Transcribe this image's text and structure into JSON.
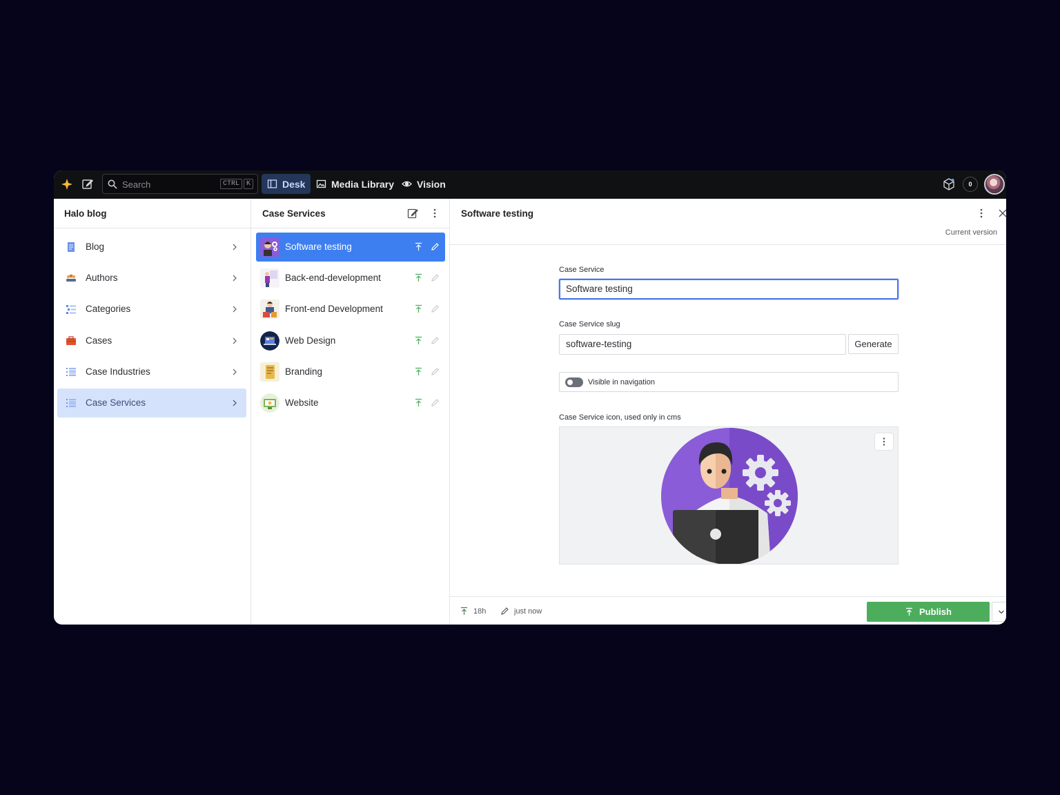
{
  "topbar": {
    "search_placeholder": "Search",
    "shortcut_keys": [
      "CTRL",
      "K"
    ],
    "nav": [
      {
        "label": "Desk",
        "icon": "desk-icon",
        "active": true
      },
      {
        "label": "Media Library",
        "icon": "image-icon",
        "active": false
      },
      {
        "label": "Vision",
        "icon": "eye-icon",
        "active": false
      }
    ],
    "notification_count": "0"
  },
  "structure": {
    "title": "Halo blog",
    "items": [
      {
        "label": "Blog",
        "icon": "document-icon",
        "selected": false
      },
      {
        "label": "Authors",
        "icon": "people-icon",
        "selected": false
      },
      {
        "label": "Categories",
        "icon": "list-icon",
        "selected": false
      },
      {
        "label": "Cases",
        "icon": "briefcase-icon",
        "selected": false
      },
      {
        "label": "Case Industries",
        "icon": "list-icon",
        "selected": false
      },
      {
        "label": "Case Services",
        "icon": "list-icon",
        "selected": true
      }
    ]
  },
  "list": {
    "title": "Case Services",
    "items": [
      {
        "label": "Software testing",
        "selected": true
      },
      {
        "label": "Back-end-development",
        "selected": false
      },
      {
        "label": "Front-end Development",
        "selected": false
      },
      {
        "label": "Web Design",
        "selected": false
      },
      {
        "label": "Branding",
        "selected": false
      },
      {
        "label": "Website",
        "selected": false
      }
    ]
  },
  "document": {
    "title": "Software testing",
    "version_label": "Current version",
    "fields": {
      "name_label": "Case Service",
      "name_value": "Software testing",
      "slug_label": "Case Service slug",
      "slug_value": "software-testing",
      "generate_label": "Generate",
      "nav_toggle_label": "Visible in navigation",
      "icon_label": "Case Service icon, used only in cms"
    },
    "footer": {
      "published_ago": "18h",
      "edited_ago": "just now",
      "publish_label": "Publish"
    }
  },
  "colors": {
    "accent": "#3d7ff0",
    "publish": "#4cae5c",
    "background": "#05041a"
  }
}
